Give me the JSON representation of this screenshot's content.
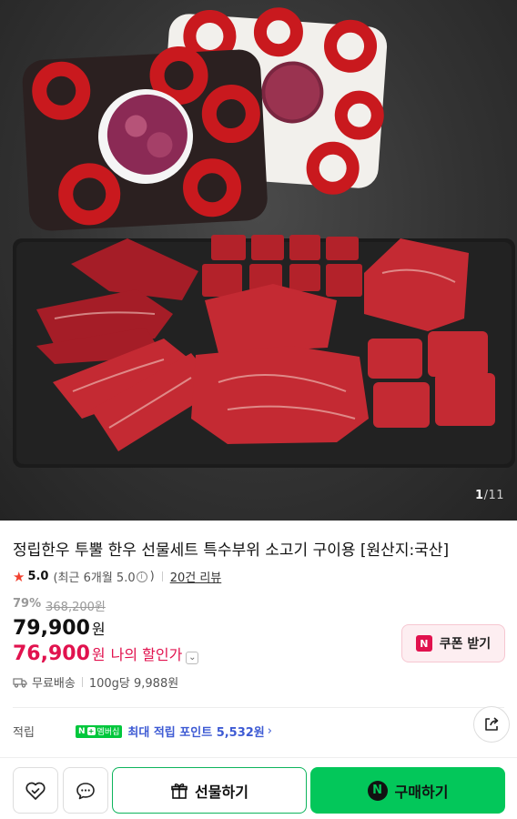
{
  "product": {
    "image_counter_current": "1",
    "image_counter_total": "/11",
    "title": "정립한우 투뿔 한우 선물세트 특수부위 소고기 구이용 [원산지:국산]",
    "rating_score": "5.0",
    "rating_recent": "(최근 6개월 5.0",
    "rating_recent_close": ")",
    "info_glyph": "i",
    "review_count": "20건 리뷰",
    "discount_rate": "79%",
    "original_price": "368,200원",
    "price": "79,900",
    "price_unit": "원",
    "my_price": "76,900",
    "my_price_unit": "원",
    "my_price_label": "나의 할인가",
    "coupon_badge": "N",
    "coupon_label": "쿠폰 받기",
    "shipping": "무료배송",
    "unit_price": "100g당 9,988원",
    "points_label": "적립",
    "membership_n": "N",
    "membership_plus": "+",
    "membership_label": "멤버십",
    "points_text": "최대 적립 포인트 5,532원",
    "gift_label": "선물하기",
    "buy_badge": "N",
    "buy_label": "구매하기"
  },
  "colors": {
    "accent_red": "#e1124e",
    "naver_green": "#03c75a",
    "points_blue": "#3e5bd4",
    "star": "#f2412f"
  },
  "icons": [
    "star-icon",
    "info-icon",
    "chevron-down-icon",
    "truck-icon",
    "share-icon",
    "heart-check-icon",
    "chat-bubble-icon",
    "gift-icon",
    "naver-n-icon"
  ]
}
